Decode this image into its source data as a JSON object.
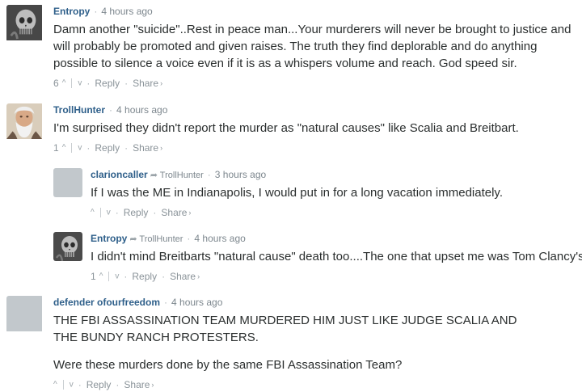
{
  "comments": [
    {
      "author": "Entropy",
      "time": "4 hours ago",
      "reply_to": "",
      "paragraphs": [
        "Damn another \"suicide\"..Rest in peace man...Your murderers will never be brought to justice and will probably be promoted and given raises. The truth they find deplorable and do anything possible to silence a voice even if it is as a whispers volume and reach. God speed sir."
      ],
      "votes": "6",
      "avatar": "skull-avatar"
    },
    {
      "author": "TrollHunter",
      "time": "4 hours ago",
      "reply_to": "",
      "paragraphs": [
        "I'm surprised they didn't report the murder as \"natural causes\" like Scalia and Breitbart."
      ],
      "votes": "1",
      "avatar": "old-man-avatar"
    },
    {
      "author": "clarioncaller",
      "time": "3 hours ago",
      "reply_to": "TrollHunter",
      "paragraphs": [
        "If I was the ME in Indianapolis, I would put in for a long vacation immediately."
      ],
      "votes": "",
      "avatar": "default-avatar"
    },
    {
      "author": "Entropy",
      "time": "4 hours ago",
      "reply_to": "TrollHunter",
      "paragraphs": [
        "I didn't mind Breitbarts \"natural cause\" death too....The one that upset me was Tom Clancy's"
      ],
      "votes": "1",
      "avatar": "skull-avatar"
    },
    {
      "author": "defender ofourfreedom",
      "time": "4 hours ago",
      "reply_to": "",
      "paragraphs": [
        "THE FBI ASSASSINATION TEAM MURDERED HIM JUST LIKE JUDGE SCALIA AND THE BUNDY RANCH PROTESTERS.",
        "Were these murders done by the same FBI Assassination Team?"
      ],
      "votes": "",
      "avatar": "default-avatar"
    }
  ],
  "labels": {
    "separator": "·",
    "reply": "Reply",
    "share": "Share",
    "share_caret": "›",
    "upvote_glyph": "^",
    "downvote_glyph": "v",
    "reply_arrow": "➦"
  },
  "colors": {
    "author": "#2e5f8a",
    "meta": "#7d878e",
    "text": "#2a2e2e",
    "default_avatar": "#c2c8cc"
  }
}
